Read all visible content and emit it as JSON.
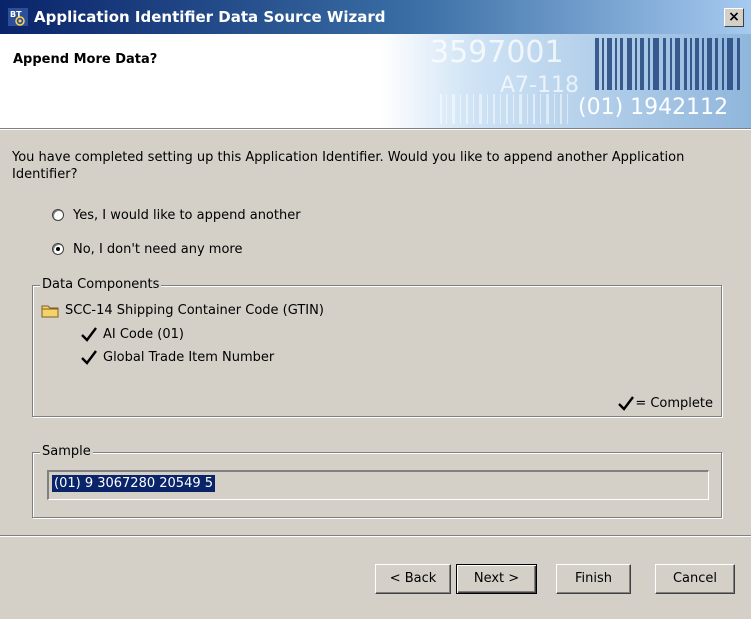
{
  "window": {
    "title": "Application Identifier Data Source Wizard",
    "close_label": "×"
  },
  "header": {
    "title": "Append More Data?",
    "barcode_text": {
      "line1": "3597001",
      "line2": "A7-118",
      "line3": "(01) 1942112"
    }
  },
  "body": {
    "instructions": "You have completed setting up this Application Identifier. Would you like to append another Application Identifier?",
    "options": [
      {
        "label": "Yes, I would like to append another",
        "selected": false
      },
      {
        "label": "No, I don't need any more",
        "selected": true
      }
    ]
  },
  "data_components": {
    "legend": "Data Components",
    "root": {
      "label": "SCC-14 Shipping Container Code (GTIN)",
      "icon": "folder-icon"
    },
    "children": [
      {
        "label": "AI Code (01)",
        "icon": "checkmark-icon"
      },
      {
        "label": "Global Trade Item Number",
        "icon": "checkmark-icon"
      }
    ],
    "complete_label": "= Complete"
  },
  "sample": {
    "legend": "Sample",
    "value": "(01) 9 3067280 20549 5"
  },
  "buttons": {
    "back": "< Back",
    "next": "Next >",
    "finish": "Finish",
    "cancel": "Cancel"
  },
  "colors": {
    "titlebar_start": "#0a246a",
    "titlebar_end": "#a6caf0",
    "dialog_face": "#d4d0c8",
    "selection": "#0a246a"
  }
}
